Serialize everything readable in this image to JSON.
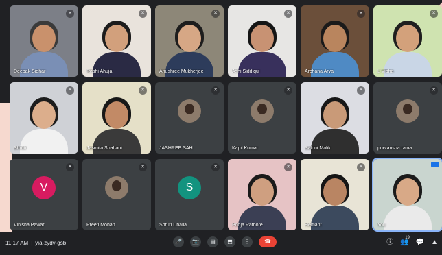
{
  "meeting": {
    "time": "11:17 AM",
    "code": "yia-zydv-gsb"
  },
  "participants": [
    {
      "name": "Deepak Sidhar",
      "kind": "video",
      "skin": "#c9916c",
      "shirt": "#7a8fb5",
      "bg": "#7c7f87",
      "hair": "#3a3a3a"
    },
    {
      "name": "Rashi Ahuja",
      "kind": "video",
      "skin": "#d2a07c",
      "shirt": "#2a2a44",
      "bg": "#e9e3dc",
      "hair": "#1c1c1c"
    },
    {
      "name": "Anushree Mukherjee",
      "kind": "video",
      "skin": "#d6a785",
      "shirt": "#2d3c5b",
      "bg": "#8d8778",
      "hair": "#1d1d1d"
    },
    {
      "name": "Ashi Siddiqui",
      "kind": "video",
      "skin": "#c89273",
      "shirt": "#38305c",
      "bg": "#e7e6e4",
      "hair": "#151515"
    },
    {
      "name": "Archana Arya",
      "kind": "video",
      "skin": "#b9855e",
      "shirt": "#4f8ac4",
      "bg": "#6b4f3a",
      "hair": "#1a1a1a"
    },
    {
      "name": "L Vibha",
      "kind": "video",
      "skin": "#d3a17b",
      "shirt": "#c9d6e6",
      "bg": "#cfe3b0",
      "hair": "#1f1f1f"
    },
    {
      "name": "Shruti",
      "kind": "video",
      "skin": "#dcae8c",
      "shirt": "#f1f1f1",
      "bg": "#cfd1d6",
      "hair": "#1c1c1c"
    },
    {
      "name": "Jasmita Shahani",
      "kind": "video",
      "skin": "#c28a66",
      "shirt": "#3a3a3a",
      "bg": "#e5e0c8",
      "hair": "#181818"
    },
    {
      "name": "JASHREE SAH",
      "kind": "avatar-photo"
    },
    {
      "name": "Kapil Kumar",
      "kind": "avatar-photo"
    },
    {
      "name": "Saloni Malik",
      "kind": "video",
      "skin": "#c99a78",
      "shirt": "#2f2f2f",
      "bg": "#dcdde3",
      "hair": "#171717"
    },
    {
      "name": "purvansha raina",
      "kind": "avatar-photo"
    },
    {
      "name": "Vinisha Pawar",
      "kind": "avatar-letter",
      "letter": "V",
      "color": "#d81b60"
    },
    {
      "name": "Preeti Mohan",
      "kind": "avatar-photo"
    },
    {
      "name": "Shruti Dhalla",
      "kind": "avatar-letter",
      "letter": "S",
      "color": "#12937f"
    },
    {
      "name": "Pooja Rathore",
      "kind": "video",
      "skin": "#cf9f80",
      "shirt": "#3b3f54",
      "bg": "#e6c3c5",
      "hair": "#1a1a1a"
    },
    {
      "name": "Hemant",
      "kind": "video",
      "skin": "#b98563",
      "shirt": "#3c4a5e",
      "bg": "#e8e4d6",
      "hair": "#161616"
    },
    {
      "name": "You",
      "kind": "video",
      "skin": "#d8a987",
      "shirt": "#eaeaea",
      "bg": "#c9d5cf",
      "hair": "#1b1b1b",
      "active": true
    }
  ],
  "controls": {
    "mic": "🎤",
    "camera": "📷",
    "captions": "▤",
    "present": "⬒",
    "more": "⋮",
    "end": "☎"
  },
  "right_controls": {
    "info": "ⓘ",
    "people": "👥",
    "people_count": "19",
    "chat": "💬",
    "activities": "▲"
  },
  "colors": {
    "background": "#202124",
    "tile": "#3c4043",
    "end_call": "#ea4335",
    "active_outline": "#8ab4f8"
  }
}
